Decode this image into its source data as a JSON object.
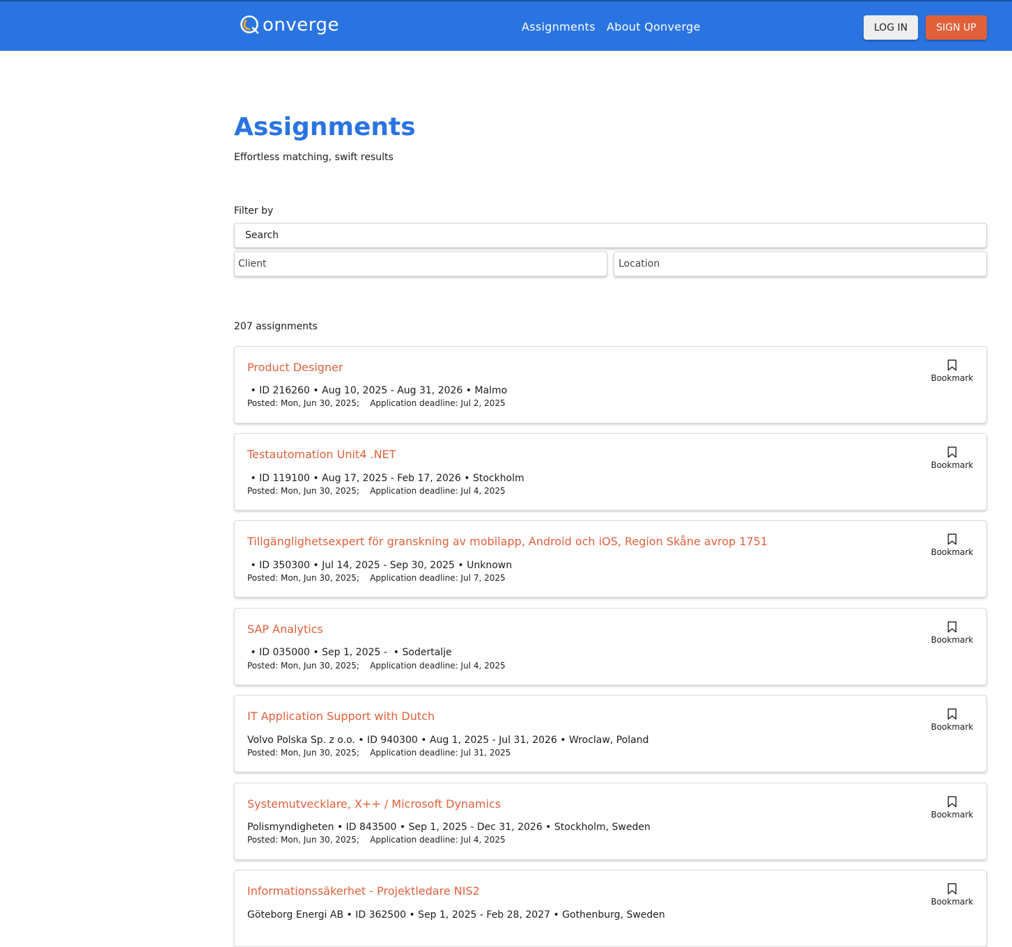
{
  "header": {
    "logo_text": "onverge",
    "nav": {
      "assignments": "Assignments",
      "about": "About Qonverge"
    },
    "login_label": "LOG IN",
    "signup_label": "SIGN UP"
  },
  "colors": {
    "header_bg": "#2a74e2",
    "accent": "#e1603a",
    "title": "#2a74e2"
  },
  "page": {
    "title": "Assignments",
    "subtitle": "Effortless matching, swift results"
  },
  "filters": {
    "label": "Filter by",
    "search_placeholder": "Search",
    "client_placeholder": "Client",
    "location_placeholder": "Location"
  },
  "results": {
    "count_text": "207 assignments"
  },
  "assignments": [
    {
      "title": "Product Designer",
      "meta": " • ID 216260 • Aug 10, 2025 - Aug 31, 2026 • Malmo",
      "dates": "Posted: Mon, Jun 30, 2025;    Application deadline: Jul 2, 2025",
      "bookmark": "Bookmark"
    },
    {
      "title": "Testautomation Unit4 .NET",
      "meta": " • ID 119100 • Aug 17, 2025 - Feb 17, 2026 • Stockholm",
      "dates": "Posted: Mon, Jun 30, 2025;    Application deadline: Jul 4, 2025",
      "bookmark": "Bookmark"
    },
    {
      "title": "Tillgänglighetsexpert för granskning av mobilapp, Android och iOS, Region Skåne avrop 1751",
      "meta": " • ID 350300 • Jul 14, 2025 - Sep 30, 2025 • Unknown",
      "dates": "Posted: Mon, Jun 30, 2025;    Application deadline: Jul 7, 2025",
      "bookmark": "Bookmark"
    },
    {
      "title": "SAP Analytics",
      "meta": " • ID 035000 • Sep 1, 2025 -  • Sodertalje",
      "dates": "Posted: Mon, Jun 30, 2025;    Application deadline: Jul 4, 2025",
      "bookmark": "Bookmark"
    },
    {
      "title": "IT Application Support with Dutch",
      "meta": "Volvo Polska Sp. z o.o. • ID 940300 • Aug 1, 2025 - Jul 31, 2026 • Wroclaw, Poland",
      "dates": "Posted: Mon, Jun 30, 2025;    Application deadline: Jul 31, 2025",
      "bookmark": "Bookmark"
    },
    {
      "title": "Systemutvecklare, X++ / Microsoft Dynamics",
      "meta": "Polismyndigheten • ID 843500 • Sep 1, 2025 - Dec 31, 2026 • Stockholm, Sweden",
      "dates": "Posted: Mon, Jun 30, 2025;    Application deadline: Jul 4, 2025",
      "bookmark": "Bookmark"
    },
    {
      "title": "Informationssäkerhet - Projektledare NIS2",
      "meta": "Göteborg Energi AB • ID 362500 • Sep 1, 2025 - Feb 28, 2027 • Gothenburg, Sweden",
      "dates": "",
      "bookmark": "Bookmark"
    }
  ]
}
